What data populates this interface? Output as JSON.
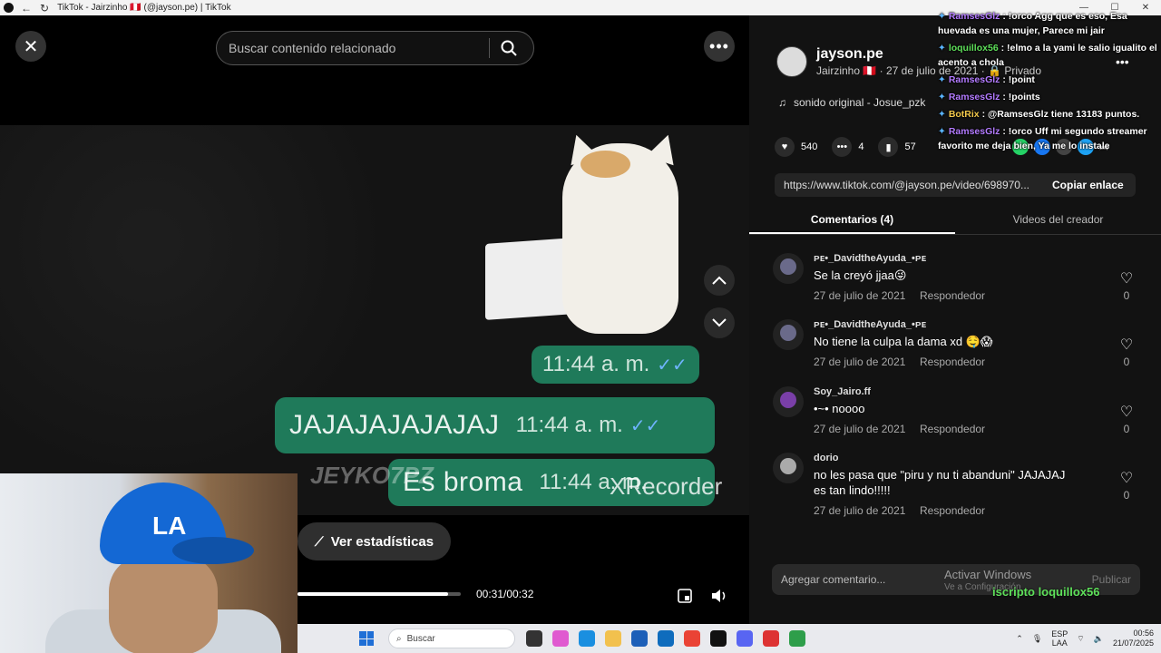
{
  "browser": {
    "tab_title": "TikTok - Jairzinho 🇵🇪 (@jayson.pe) | TikTok"
  },
  "video": {
    "search": {
      "placeholder": "Buscar contenido relacionado"
    },
    "bubbles": {
      "time_1": "11:44 a. m.",
      "main_2": "JAJAJAJAJAJAJ",
      "time_2": "11:44 a. m.",
      "main_3": "Es broma",
      "time_3": "11:44 a. m."
    },
    "watermarks": {
      "left": "JEYKO7PZ",
      "right": "XRecorder"
    },
    "stats_label": "Ver estadísticas",
    "time": "00:31/00:32",
    "progress_fraction": 0.92
  },
  "post": {
    "username": "jayson.pe",
    "meta": "Jairzinho 🇵🇪 · 27 de julio de 2021 · 🔒 Privado",
    "sound": "sonido original - Josue_pzk",
    "likes": "540",
    "comments": "4",
    "saves": "57",
    "url": "https://www.tiktok.com/@jayson.pe/video/698970...",
    "copy_label": "Copiar enlace"
  },
  "tabs": {
    "comments": "Comentarios (4)",
    "creator_videos": "Videos del creador"
  },
  "comments": [
    {
      "name": "ᴘᴇ•_DavidtheAyuda_•ᴘᴇ",
      "text": "Se la creyó jjaa😜",
      "date": "27 de julio de 2021",
      "reply": "Respondedor",
      "likes": "0"
    },
    {
      "name": "ᴘᴇ•_DavidtheAyuda_•ᴘᴇ",
      "text": "No tiene la culpa la dama xd 🤤😱",
      "date": "27 de julio de 2021",
      "reply": "Respondedor",
      "likes": "0"
    },
    {
      "name": "Soy_Jairo.ff",
      "text": "•~• noooo",
      "date": "27 de julio de 2021",
      "reply": "Respondedor",
      "likes": "0"
    },
    {
      "name": "dorio",
      "text": "no les pasa que \"piru y nu ti abanduni\" JAJAJAJ es tan lindo!!!!!",
      "date": "27 de julio de 2021",
      "reply": "Respondedor",
      "likes": "0"
    }
  ],
  "add_comment": {
    "placeholder": "Agregar comentario...",
    "publish": "Publicar"
  },
  "activate_windows": {
    "title": "Activar Windows",
    "subtitle": "Ve a Configuración"
  },
  "stream_overlay": {
    "chat": [
      {
        "user": "RamsesGlz",
        "msg": "!orco Agg que es eso, Esa huevada es una mujer, Parece mi jair"
      },
      {
        "user": "loquillox56",
        "msg": "!elmo a la yami le salio igualito el acento a chola"
      },
      {
        "user": "RamsesGlz",
        "msg": "!point"
      },
      {
        "user": "RamsesGlz",
        "msg": "!points"
      },
      {
        "user": "BotRix",
        "msg": "@RamsesGlz tiene 13183 puntos."
      },
      {
        "user": "RamsesGlz",
        "msg": "!orco Uff mi segundo streamer favorito me deja bien, Ya me lo instale"
      }
    ],
    "bottom_text": "iscripto loquillox56"
  },
  "taskbar": {
    "search_label": "Buscar",
    "lang_top": "ESP",
    "lang_bottom": "LAA",
    "time": "00:56",
    "date": "21/07/2025"
  }
}
